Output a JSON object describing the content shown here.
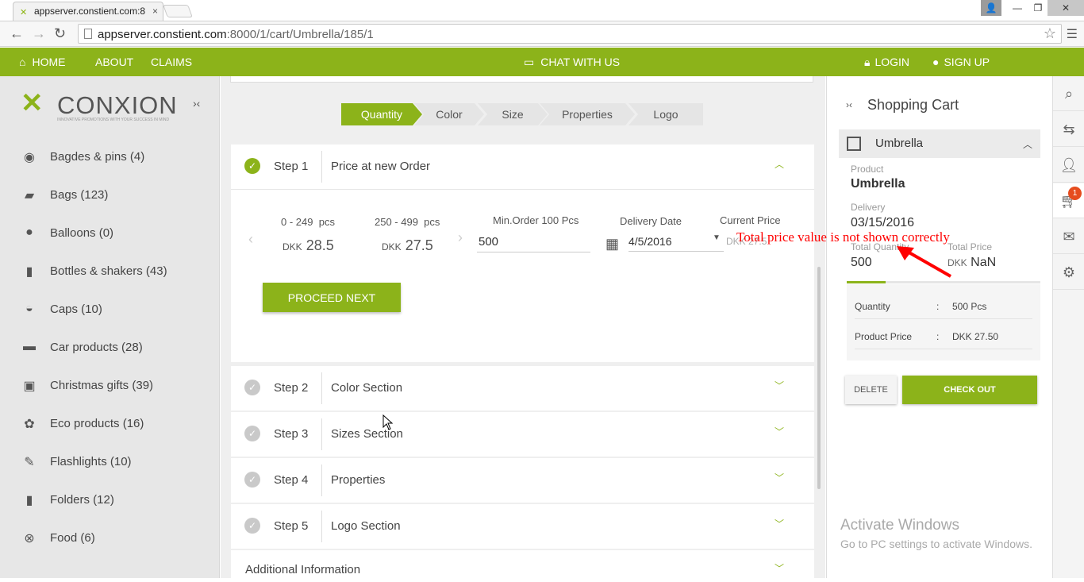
{
  "browser": {
    "tab_title": "appserver.constient.com:8",
    "url_host": "appserver.constient.com",
    "url_path": ":8000/1/cart/Umbrella/185/1"
  },
  "navbar": {
    "home": "HOME",
    "about": "ABOUT",
    "claims": "CLAIMS",
    "chat": "CHAT WITH US",
    "login": "LOGIN",
    "signup": "SIGN UP"
  },
  "logo": {
    "name": "CONXION",
    "tagline": "INNOVATIVE PROMOTIONS WITH YOUR SUCCESS IN MIND"
  },
  "categories": [
    {
      "label": "Bagdes & pins (4)",
      "icon": "badge-icon"
    },
    {
      "label": "Bags (123)",
      "icon": "bag-icon"
    },
    {
      "label": "Balloons (0)",
      "icon": "balloon-icon"
    },
    {
      "label": "Bottles & shakers (43)",
      "icon": "bottle-icon"
    },
    {
      "label": "Caps (10)",
      "icon": "cap-icon"
    },
    {
      "label": "Car products (28)",
      "icon": "car-icon"
    },
    {
      "label": "Christmas gifts (39)",
      "icon": "gift-icon"
    },
    {
      "label": "Eco products (16)",
      "icon": "eco-icon"
    },
    {
      "label": "Flashlights (10)",
      "icon": "flashlight-icon"
    },
    {
      "label": "Folders (12)",
      "icon": "folder-icon"
    },
    {
      "label": "Food (6)",
      "icon": "food-icon"
    }
  ],
  "breadcrumb": [
    "Quantity",
    "Color",
    "Size",
    "Properties",
    "Logo"
  ],
  "steps": [
    {
      "num": "Step 1",
      "title": "Price at new Order"
    },
    {
      "num": "Step 2",
      "title": "Color Section"
    },
    {
      "num": "Step 3",
      "title": "Sizes Section"
    },
    {
      "num": "Step 4",
      "title": "Properties"
    },
    {
      "num": "Step 5",
      "title": "Logo Section"
    }
  ],
  "additional_info": "Additional Information",
  "pricing": {
    "tier1_range": "0 - 249",
    "tier1_unit": "pcs",
    "tier1_currency": "DKK",
    "tier1_price": "28.5",
    "tier2_range": "250 - 499",
    "tier2_unit": "pcs",
    "tier2_currency": "DKK",
    "tier2_price": "27.5",
    "min_order_label": "Min.Order 100 Pcs",
    "qty_value": "500",
    "delivery_label": "Delivery Date",
    "delivery_value": "4/5/2016",
    "current_price_label": "Current Price",
    "current_price_value": "DKK 27.5"
  },
  "proceed_label": "PROCEED NEXT",
  "cart": {
    "title": "Shopping Cart",
    "item_name": "Umbrella",
    "product_label": "Product",
    "product_value": "Umbrella",
    "delivery_label": "Delivery",
    "delivery_value": "03/15/2016",
    "total_qty_label": "Total Quantity",
    "total_qty_value": "500",
    "total_price_label": "Total Price",
    "total_price_currency": "DKK",
    "total_price_value": "NaN",
    "progress": 0.2,
    "details": [
      {
        "label": "Quantity",
        "sep": ":",
        "value": "500 Pcs"
      },
      {
        "label": "Product Price",
        "sep": ":",
        "value": "DKK 27.50"
      }
    ],
    "delete_label": "DELETE",
    "checkout_label": "CHECK OUT",
    "badge_count": "1"
  },
  "watermark": {
    "line1": "Activate Windows",
    "line2": "Go to PC settings to activate Windows."
  },
  "annotation": "Total  price value is not  shown correctly",
  "colors": {
    "accent": "#8cb31a",
    "badge": "#e64c1e",
    "annotation": "#ff0000"
  }
}
